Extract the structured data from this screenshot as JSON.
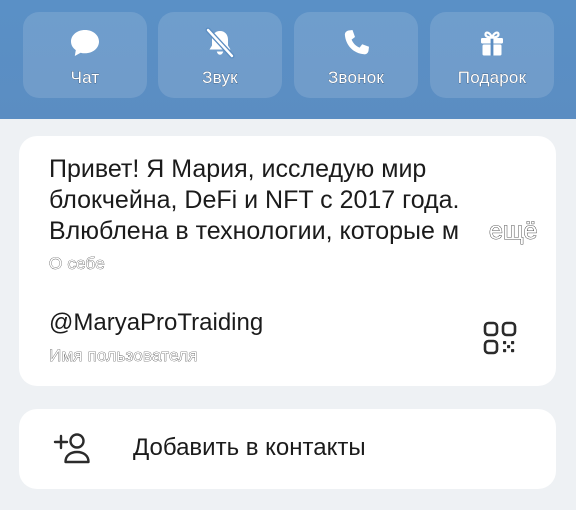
{
  "actions": [
    {
      "label": "Чат",
      "icon": "chat-bubble-icon"
    },
    {
      "label": "Звук",
      "icon": "bell-muted-icon"
    },
    {
      "label": "Звонок",
      "icon": "phone-icon"
    },
    {
      "label": "Подарок",
      "icon": "gift-icon"
    }
  ],
  "profile": {
    "bio": "Привет! Я Мария, исследую мир блокчейна, DeFi и NFT с 2017 года. Влюблена в технологии, которые м",
    "bio_more": "ещё",
    "bio_caption": "О себе",
    "username": "@MaryaProTraiding",
    "username_caption": "Имя пользователя",
    "qr_icon": "qr-code-icon"
  },
  "add_contact": {
    "label": "Добавить в контакты",
    "icon": "add-user-icon"
  },
  "colors": {
    "header": "#5b8dc2",
    "background": "#eef1f4",
    "card": "#ffffff"
  }
}
